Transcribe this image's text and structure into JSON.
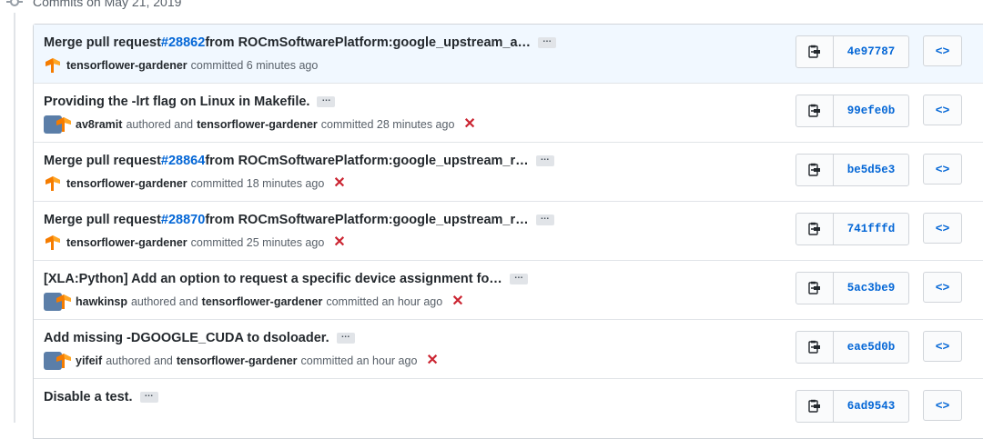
{
  "group": {
    "title": "Commits on May 21, 2019"
  },
  "commits": [
    {
      "title_prefix": "Merge pull request ",
      "pr": "#28862",
      "title_suffix": " from ROCmSoftwarePlatform:google_upstream_a…",
      "author": "",
      "author_text": "",
      "committer": "tensorflower-gardener",
      "committed_text": "committed 6 minutes ago",
      "status": "",
      "sha": "4e97787",
      "avatar": "tensorflower"
    },
    {
      "title_prefix": "Providing the -lrt flag on Linux in Makefile.",
      "pr": "",
      "title_suffix": "",
      "author": "av8ramit",
      "author_text": "authored and",
      "committer": "tensorflower-gardener",
      "committed_text": "committed 28 minutes ago",
      "status": "✕",
      "sha": "99efe0b",
      "avatar": "pair"
    },
    {
      "title_prefix": "Merge pull request ",
      "pr": "#28864",
      "title_suffix": " from ROCmSoftwarePlatform:google_upstream_r…",
      "author": "",
      "author_text": "",
      "committer": "tensorflower-gardener",
      "committed_text": "committed 18 minutes ago",
      "status": "✕",
      "sha": "be5d5e3",
      "avatar": "tensorflower"
    },
    {
      "title_prefix": "Merge pull request ",
      "pr": "#28870",
      "title_suffix": " from ROCmSoftwarePlatform:google_upstream_r…",
      "author": "",
      "author_text": "",
      "committer": "tensorflower-gardener",
      "committed_text": "committed 25 minutes ago",
      "status": "✕",
      "sha": "741fffd",
      "avatar": "tensorflower"
    },
    {
      "title_prefix": "[XLA:Python] Add an option to request a specific device assignment fo…",
      "pr": "",
      "title_suffix": "",
      "author": "hawkinsp",
      "author_text": "authored and",
      "committer": "tensorflower-gardener",
      "committed_text": "committed an hour ago",
      "status": "✕",
      "sha": "5ac3be9",
      "avatar": "pair"
    },
    {
      "title_prefix": "Add missing -DGOOGLE_CUDA to dsoloader.",
      "pr": "",
      "title_suffix": "",
      "author": "yifeif",
      "author_text": "authored and",
      "committer": "tensorflower-gardener",
      "committed_text": "committed an hour ago",
      "status": "✕",
      "sha": "eae5d0b",
      "avatar": "pair"
    },
    {
      "title_prefix": "Disable a test.",
      "pr": "",
      "title_suffix": "",
      "author": "",
      "author_text": "",
      "committer": "",
      "committed_text": "",
      "status": "",
      "sha": "6ad9543",
      "avatar": ""
    }
  ],
  "buttons": {
    "ellipsis": "…",
    "browse": "<>"
  },
  "icons": {
    "clipboard": "clipboard-icon",
    "browse": "code-icon",
    "dot": "git-commit-icon",
    "status_fail": "x-icon"
  },
  "colors": {
    "link": "#0366d6",
    "fail": "#cb2431",
    "highlight": "#f1f8ff"
  }
}
